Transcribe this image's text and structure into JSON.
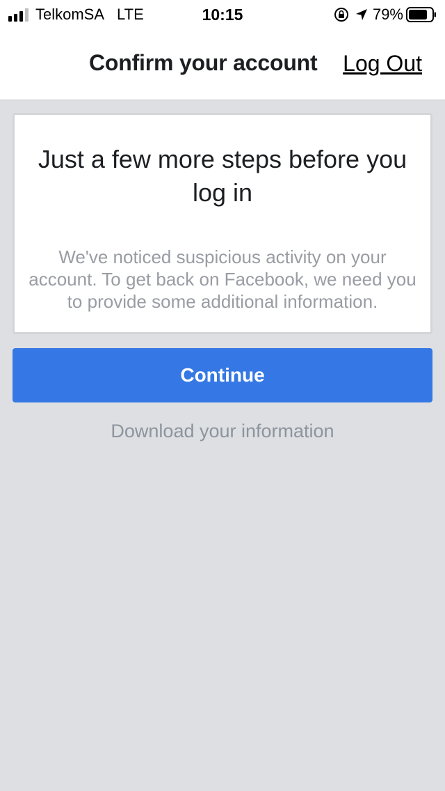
{
  "status_bar": {
    "carrier": "TelkomSA",
    "network": "LTE",
    "time": "10:15",
    "battery": "79%",
    "icons": [
      "signal-icon",
      "rotation-lock-icon",
      "location-arrow-icon",
      "battery-icon"
    ]
  },
  "header": {
    "title": "Confirm your account",
    "logout_label": "Log Out"
  },
  "card": {
    "title": "Just a few more steps before you log in",
    "body": "We've noticed suspicious activity on your account. To get back on Facebook, we need you to provide some additional information."
  },
  "actions": {
    "continue_label": "Continue",
    "download_label": "Download your information"
  },
  "colors": {
    "background": "#dddfe2",
    "primary_button": "#3578e5",
    "card_border": "#d3d5d9",
    "muted_text": "#999ca3"
  }
}
